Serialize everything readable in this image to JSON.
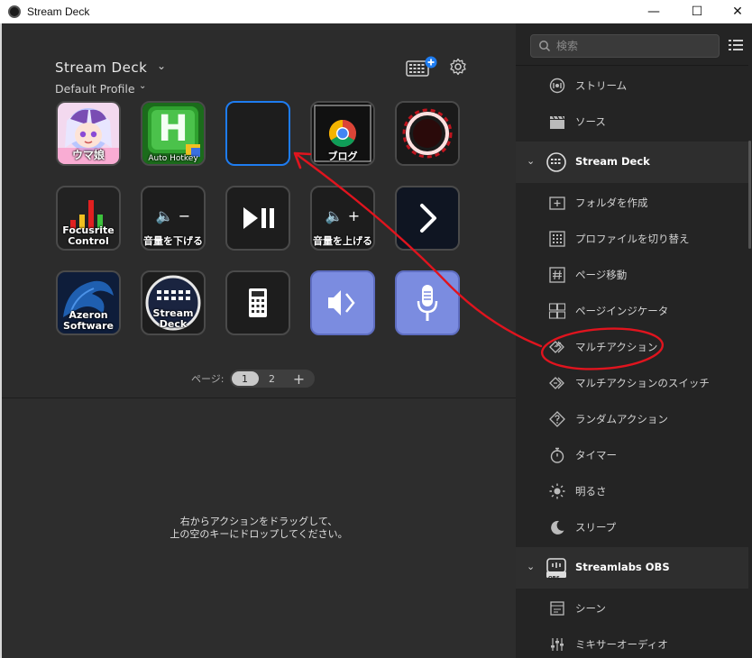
{
  "window": {
    "title": "Stream Deck",
    "minimize": "—",
    "maximize": "☐",
    "close": "✕"
  },
  "header": {
    "device_name": "Stream Deck",
    "profile_name": "Default Profile"
  },
  "keys": [
    {
      "label": "ウマ娘"
    },
    {
      "label": "Auto Hotkey",
      "letter": "H"
    },
    {
      "label": ""
    },
    {
      "label": "ブログ"
    },
    {
      "label": ""
    },
    {
      "label": "Focusrite\nControl"
    },
    {
      "label": "音量を下げる",
      "symbol": "🔈 −"
    },
    {
      "label": ""
    },
    {
      "label": "音量を上げる",
      "symbol": "🔈 +"
    },
    {
      "label": ""
    },
    {
      "label": "Azeron\nSoftware"
    },
    {
      "label": "Stream\nDeck"
    },
    {
      "label": ""
    },
    {
      "label": ""
    },
    {
      "label": ""
    }
  ],
  "pager": {
    "label": "ページ:",
    "pages": [
      "1",
      "2"
    ],
    "add": "+"
  },
  "drop_hint": {
    "line1": "右からアクションをドラッグして、",
    "line2": "上の空のキーにドロップしてください。"
  },
  "sidebar": {
    "search_placeholder": "検索",
    "items_top": [
      {
        "label": "ストリーム"
      },
      {
        "label": "ソース"
      }
    ],
    "category_streamdeck": "Stream Deck",
    "items_sd": [
      {
        "label": "フォルダを作成"
      },
      {
        "label": "プロファイルを切り替え"
      },
      {
        "label": "ページ移動"
      },
      {
        "label": "ページインジケータ"
      },
      {
        "label": "マルチアクション"
      },
      {
        "label": "マルチアクションのスイッチ"
      },
      {
        "label": "ランダムアクション"
      },
      {
        "label": "タイマー"
      },
      {
        "label": "明るさ"
      },
      {
        "label": "スリープ"
      }
    ],
    "category_slobs": "Streamlabs OBS",
    "slobs_badge": "OBS",
    "items_slobs": [
      {
        "label": "シーン"
      },
      {
        "label": "ミキサーオーディオ"
      }
    ]
  },
  "colors": {
    "accent": "#1e7cf0",
    "annotation": "#e0141e",
    "key_blue": "#7b8ce0"
  }
}
